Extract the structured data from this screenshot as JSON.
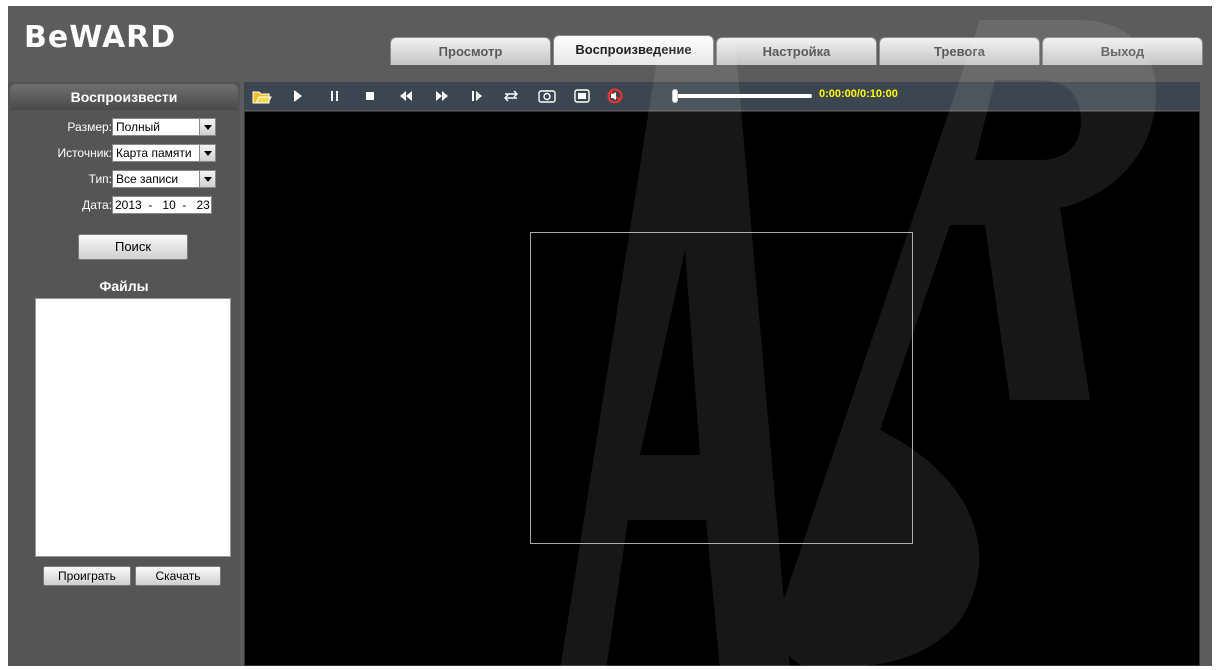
{
  "brand": {
    "logo_text": "BeWARD"
  },
  "nav": {
    "tabs": [
      {
        "label": "Просмотр",
        "active": false
      },
      {
        "label": "Воспроизведение",
        "active": true
      },
      {
        "label": "Настройка",
        "active": false
      },
      {
        "label": "Тревога",
        "active": false
      },
      {
        "label": "Выход",
        "active": false
      }
    ]
  },
  "sidebar": {
    "title": "Воспроизвести",
    "size": {
      "label": "Размер:",
      "value": "Полный"
    },
    "source": {
      "label": "Источник:",
      "value": "Карта памяти"
    },
    "type": {
      "label": "Тип:",
      "value": "Все записи"
    },
    "date": {
      "label": "Дата:",
      "year": "2013",
      "month": "10",
      "day": "23"
    },
    "search_label": "Поиск",
    "files_title": "Файлы",
    "play_label": "Проиграть",
    "download_label": "Скачать"
  },
  "player": {
    "timecode": "0:00:00/0:10:00",
    "progress": 0.0,
    "icons": [
      "open-folder-icon",
      "play-icon",
      "pause-icon",
      "stop-icon",
      "rewind-icon",
      "fast-forward-icon",
      "step-frame-icon",
      "loop-icon",
      "snapshot-icon",
      "fullscreen-icon",
      "mute-icon"
    ]
  },
  "colors": {
    "panel_bg": "#5c5c5c",
    "toolbar_bg": "#3b4650",
    "timecode": "#ffff00",
    "icon": "#ffffff",
    "mute_icon": "#ff3030",
    "folder_icon": "#f0c020"
  }
}
